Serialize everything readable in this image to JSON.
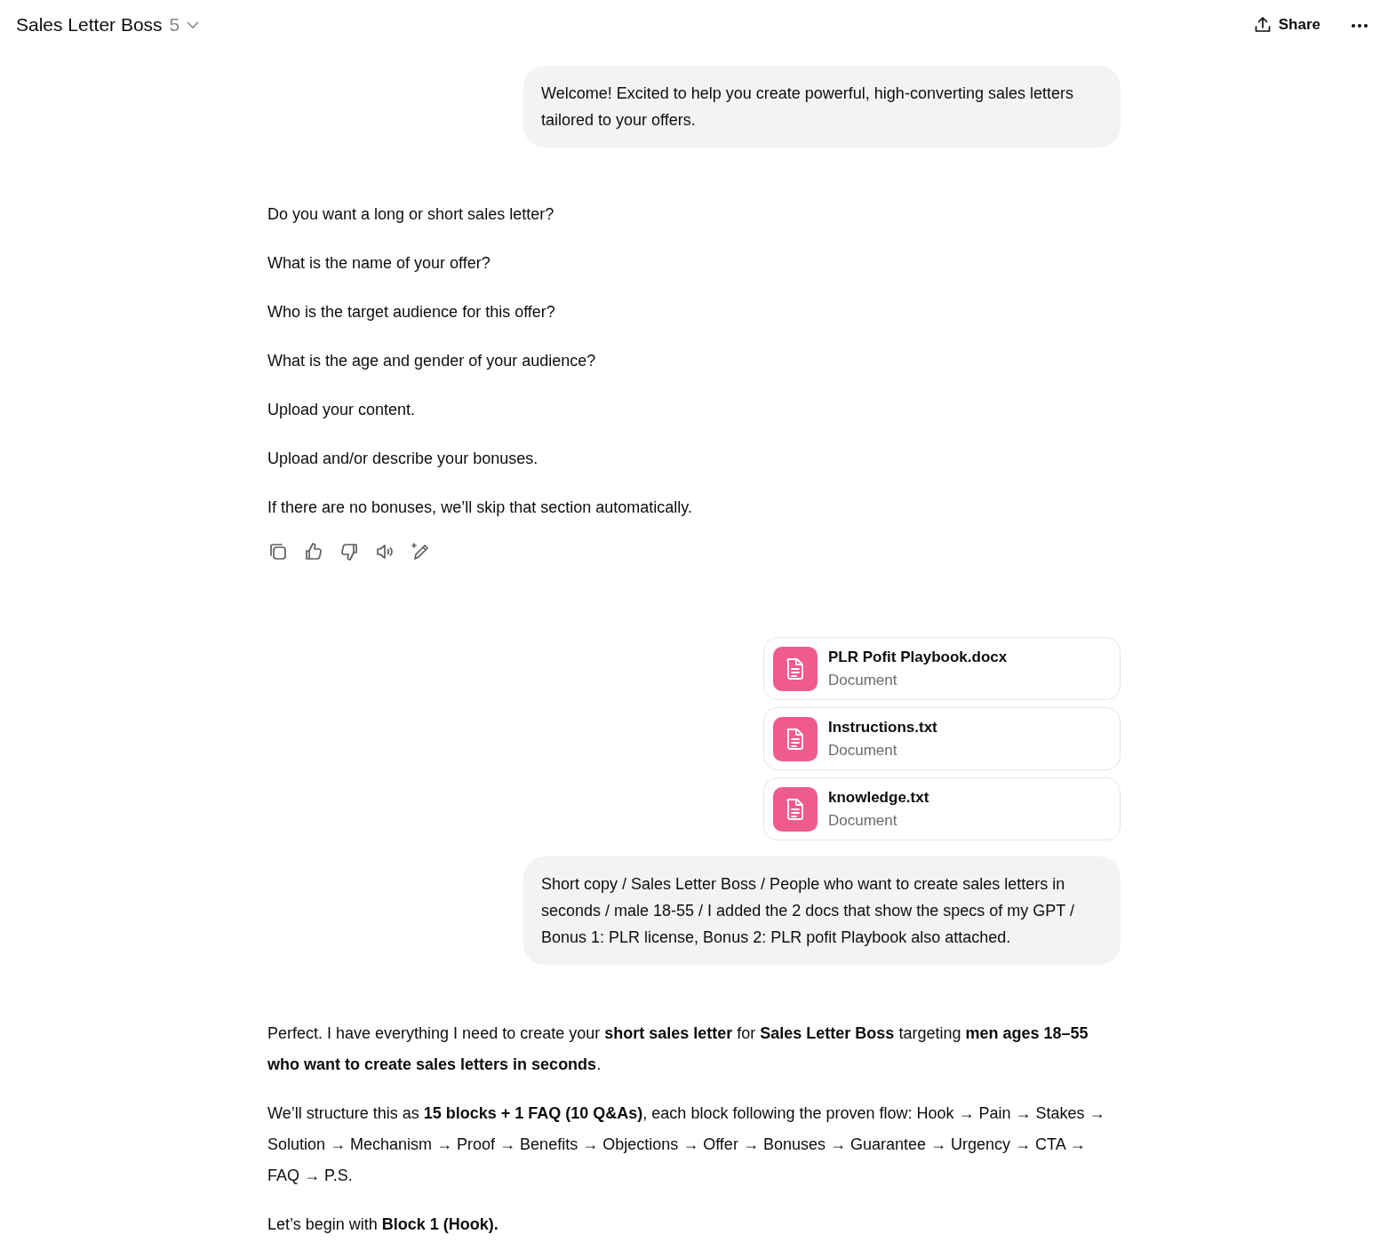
{
  "header": {
    "title": "Sales Letter Boss",
    "version": "5",
    "share": "Share"
  },
  "messages": [
    {
      "kind": "user",
      "text": "Welcome! Excited to help you create powerful, high-converting sales letters tailored to your offers."
    },
    {
      "kind": "assistant",
      "actions": true,
      "paragraphs": [
        "Do you want a long or short sales letter?",
        "What is the name of your offer?",
        "Who is the target audience for this offer?",
        "What is the age and gender of your audience?",
        "Upload your content.",
        "Upload and/or describe your bonuses.",
        "If there are no bonuses, we’ll skip that section automatically."
      ]
    },
    {
      "kind": "files",
      "files": [
        {
          "name": "PLR Pofit Playbook.docx",
          "type": "Document"
        },
        {
          "name": "Instructions.txt",
          "type": "Document"
        },
        {
          "name": "knowledge.txt",
          "type": "Document"
        }
      ]
    },
    {
      "kind": "user",
      "text": "Short copy / Sales Letter Boss / People who want to create sales letters in seconds / male 18-55 / I added the 2 docs that show the specs of my GPT /  Bonus 1: PLR license, Bonus 2: PLR pofit Playbook also attached."
    },
    {
      "kind": "assistant",
      "actions": false,
      "paragraphs": [
        "Perfect. I have everything I need to create your **short sales letter** for **Sales Letter Boss** targeting **men ages 18–55 who want to create sales letters in seconds**.",
        "We’ll structure this as **15 blocks + 1 FAQ (10 Q&As)**, each block following the proven flow: Hook → Pain → Stakes → Solution → Mechanism → Proof → Benefits → Objections → Offer → Bonuses → Guarantee → Urgency → CTA → FAQ → P.S.",
        "Let’s begin with **Block 1 (Hook).**"
      ]
    }
  ]
}
